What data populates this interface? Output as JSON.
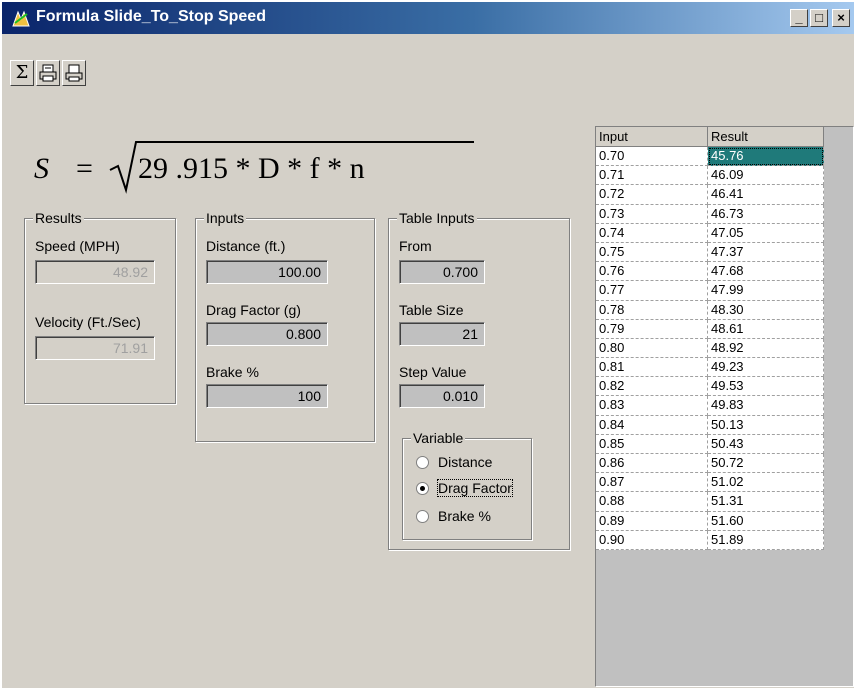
{
  "window": {
    "title": "Formula Slide_To_Stop Speed",
    "minimize_label": "_",
    "maximize_label": "□",
    "close_label": "×"
  },
  "toolbar": {
    "sigma_label": "Σ",
    "print_preview_icon": "print-preview-icon",
    "print_icon": "printer-icon"
  },
  "formula": {
    "lhs": "S",
    "equals": "=",
    "radicand": "29 .915 * D * f * n"
  },
  "results": {
    "title": "Results",
    "speed_label": "Speed (MPH)",
    "speed_value": "48.92",
    "velocity_label": "Velocity (Ft./Sec)",
    "velocity_value": "71.91"
  },
  "inputs": {
    "title": "Inputs",
    "distance_label": "Distance (ft.)",
    "distance_value": "100.00",
    "drag_label": "Drag Factor (g)",
    "drag_value": "0.800",
    "brake_label": "Brake %",
    "brake_value": "100"
  },
  "table_inputs": {
    "title": "Table Inputs",
    "from_label": "From",
    "from_value": "0.700",
    "size_label": "Table Size",
    "size_value": "21",
    "step_label": "Step Value",
    "step_value": "0.010",
    "variable": {
      "title": "Variable",
      "options": [
        "Distance",
        "Drag Factor",
        "Brake %"
      ],
      "selected": "Drag Factor"
    }
  },
  "grid": {
    "headers": [
      "Input",
      "Result"
    ],
    "rows": [
      [
        "0.70",
        "45.76"
      ],
      [
        "0.71",
        "46.09"
      ],
      [
        "0.72",
        "46.41"
      ],
      [
        "0.73",
        "46.73"
      ],
      [
        "0.74",
        "47.05"
      ],
      [
        "0.75",
        "47.37"
      ],
      [
        "0.76",
        "47.68"
      ],
      [
        "0.77",
        "47.99"
      ],
      [
        "0.78",
        "48.30"
      ],
      [
        "0.79",
        "48.61"
      ],
      [
        "0.80",
        "48.92"
      ],
      [
        "0.81",
        "49.23"
      ],
      [
        "0.82",
        "49.53"
      ],
      [
        "0.83",
        "49.83"
      ],
      [
        "0.84",
        "50.13"
      ],
      [
        "0.85",
        "50.43"
      ],
      [
        "0.86",
        "50.72"
      ],
      [
        "0.87",
        "51.02"
      ],
      [
        "0.88",
        "51.31"
      ],
      [
        "0.89",
        "51.60"
      ],
      [
        "0.90",
        "51.89"
      ]
    ],
    "selected_cell": "45.76"
  },
  "colors": {
    "title_gradient_start": "#0a246a",
    "title_gradient_end": "#a6caf0",
    "face": "#d4d0c8",
    "selection": "#1f7a7a"
  }
}
